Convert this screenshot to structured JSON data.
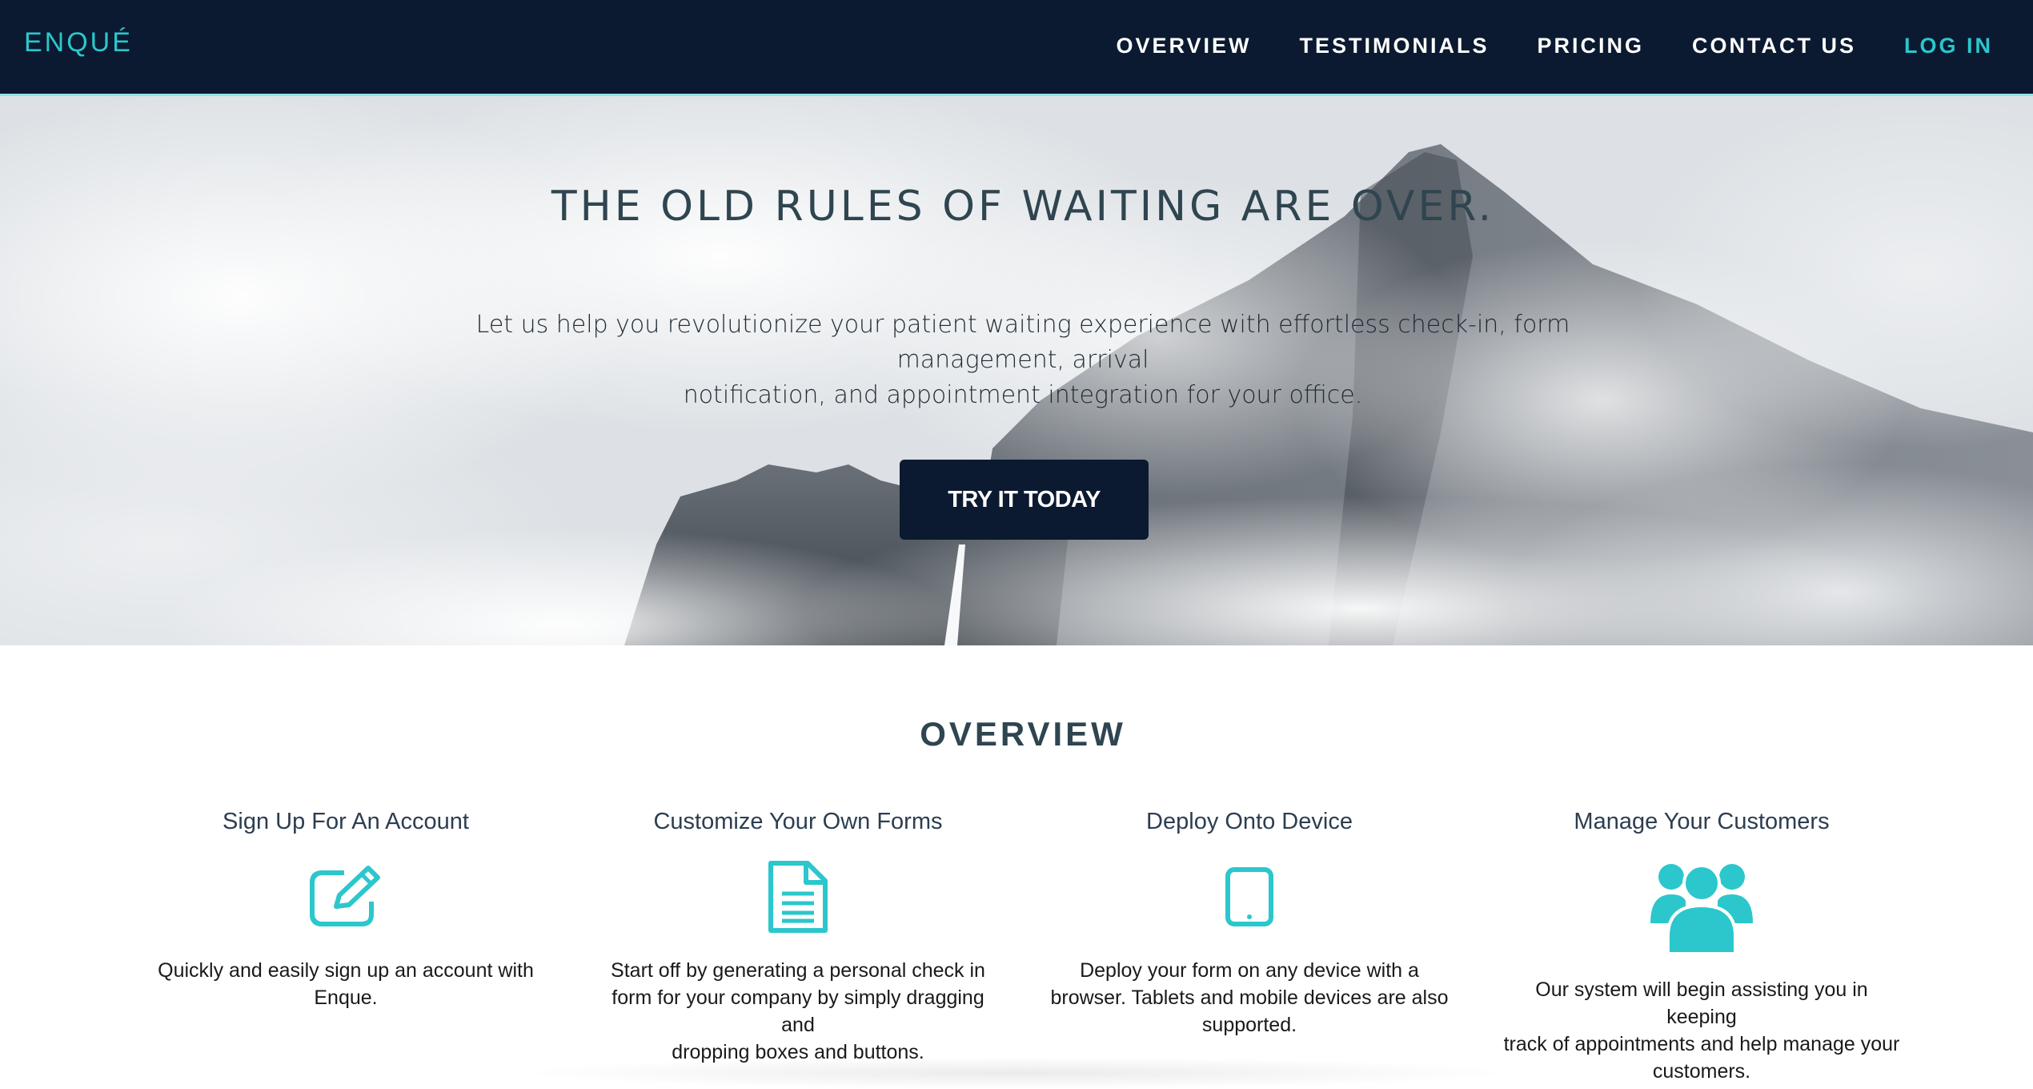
{
  "brand": {
    "name": "ENQUÉ"
  },
  "nav": {
    "items": [
      "OVERVIEW",
      "TESTIMONIALS",
      "PRICING",
      "CONTACT US"
    ],
    "login": "LOG IN"
  },
  "hero": {
    "title": "THE OLD RULES OF WAITING ARE OVER.",
    "subtitle_line1": "Let us help you revolutionize your patient waiting experience with effortless check-in, form management, arrival",
    "subtitle_line2": "notification, and appointment integration for your office.",
    "cta": "TRY IT TODAY"
  },
  "overview": {
    "title": "OVERVIEW",
    "features": [
      {
        "title": "Sign Up For An Account",
        "icon": "edit-icon",
        "text_lines": [
          "Quickly and easily sign up an account with",
          "Enque."
        ]
      },
      {
        "title": "Customize Your Own Forms",
        "icon": "document-icon",
        "text_lines": [
          "Start off by generating a personal check in",
          "form for your company by simply dragging and",
          "dropping boxes and buttons."
        ]
      },
      {
        "title": "Deploy Onto Device",
        "icon": "tablet-icon",
        "text_lines": [
          "Deploy your form on any device with a",
          "browser. Tablets and mobile devices are also",
          "supported."
        ]
      },
      {
        "title": "Manage Your Customers",
        "icon": "users-icon",
        "text_lines": [
          "Our system will begin assisting you in keeping",
          "track of appointments and help manage your",
          "customers."
        ]
      }
    ]
  },
  "colors": {
    "navy": "#0b1a30",
    "accent": "#2bc7cc",
    "heading": "#2f4550"
  }
}
